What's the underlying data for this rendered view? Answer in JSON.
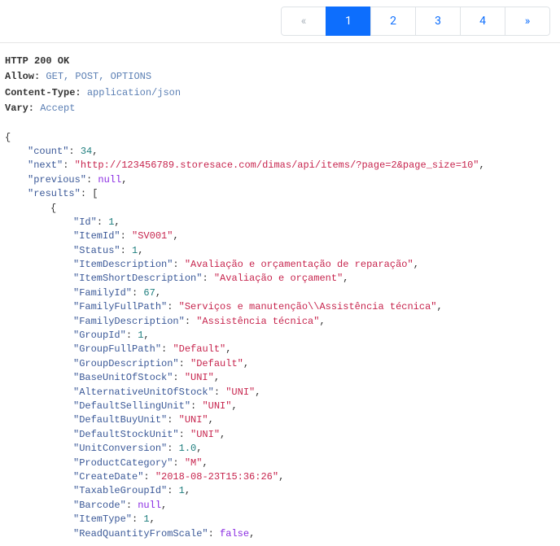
{
  "pagination": {
    "prev": "«",
    "next": "»",
    "pages": [
      "1",
      "2",
      "3",
      "4"
    ],
    "active": "1"
  },
  "headers": {
    "status_line": "HTTP 200 OK",
    "allow_label": "Allow:",
    "allow_value": "GET, POST, OPTIONS",
    "content_type_label": "Content-Type:",
    "content_type_value": "application/json",
    "vary_label": "Vary:",
    "vary_value": "Accept"
  },
  "json": {
    "count_key": "\"count\"",
    "count_val": "34",
    "next_key": "\"next\"",
    "next_val": "\"http://123456789.storesace.com/dimas/api/items/?page=2&page_size=10\"",
    "previous_key": "\"previous\"",
    "previous_val": "null",
    "results_key": "\"results\"",
    "item": {
      "Id_k": "\"Id\"",
      "Id_v": "1",
      "ItemId_k": "\"ItemId\"",
      "ItemId_v": "\"SV001\"",
      "Status_k": "\"Status\"",
      "Status_v": "1",
      "ItemDescription_k": "\"ItemDescription\"",
      "ItemDescription_v": "\"Avaliação e orçamentação de reparação\"",
      "ItemShortDescription_k": "\"ItemShortDescription\"",
      "ItemShortDescription_v": "\"Avaliação e orçament\"",
      "FamilyId_k": "\"FamilyId\"",
      "FamilyId_v": "67",
      "FamilyFullPath_k": "\"FamilyFullPath\"",
      "FamilyFullPath_v": "\"Serviços e manutenção\\\\Assistência técnica\"",
      "FamilyDescription_k": "\"FamilyDescription\"",
      "FamilyDescription_v": "\"Assistência técnica\"",
      "GroupId_k": "\"GroupId\"",
      "GroupId_v": "1",
      "GroupFullPath_k": "\"GroupFullPath\"",
      "GroupFullPath_v": "\"Default\"",
      "GroupDescription_k": "\"GroupDescription\"",
      "GroupDescription_v": "\"Default\"",
      "BaseUnitOfStock_k": "\"BaseUnitOfStock\"",
      "BaseUnitOfStock_v": "\"UNI\"",
      "AlternativeUnitOfStock_k": "\"AlternativeUnitOfStock\"",
      "AlternativeUnitOfStock_v": "\"UNI\"",
      "DefaultSellingUnit_k": "\"DefaultSellingUnit\"",
      "DefaultSellingUnit_v": "\"UNI\"",
      "DefaultBuyUnit_k": "\"DefaultBuyUnit\"",
      "DefaultBuyUnit_v": "\"UNI\"",
      "DefaultStockUnit_k": "\"DefaultStockUnit\"",
      "DefaultStockUnit_v": "\"UNI\"",
      "UnitConversion_k": "\"UnitConversion\"",
      "UnitConversion_v": "1.0",
      "ProductCategory_k": "\"ProductCategory\"",
      "ProductCategory_v": "\"M\"",
      "CreateDate_k": "\"CreateDate\"",
      "CreateDate_v": "\"2018-08-23T15:36:26\"",
      "TaxableGroupId_k": "\"TaxableGroupId\"",
      "TaxableGroupId_v": "1",
      "Barcode_k": "\"Barcode\"",
      "Barcode_v": "null",
      "ItemType_k": "\"ItemType\"",
      "ItemType_v": "1",
      "ReadQuantityFromScale_k": "\"ReadQuantityFromScale\"",
      "ReadQuantityFromScale_v": "false"
    }
  }
}
